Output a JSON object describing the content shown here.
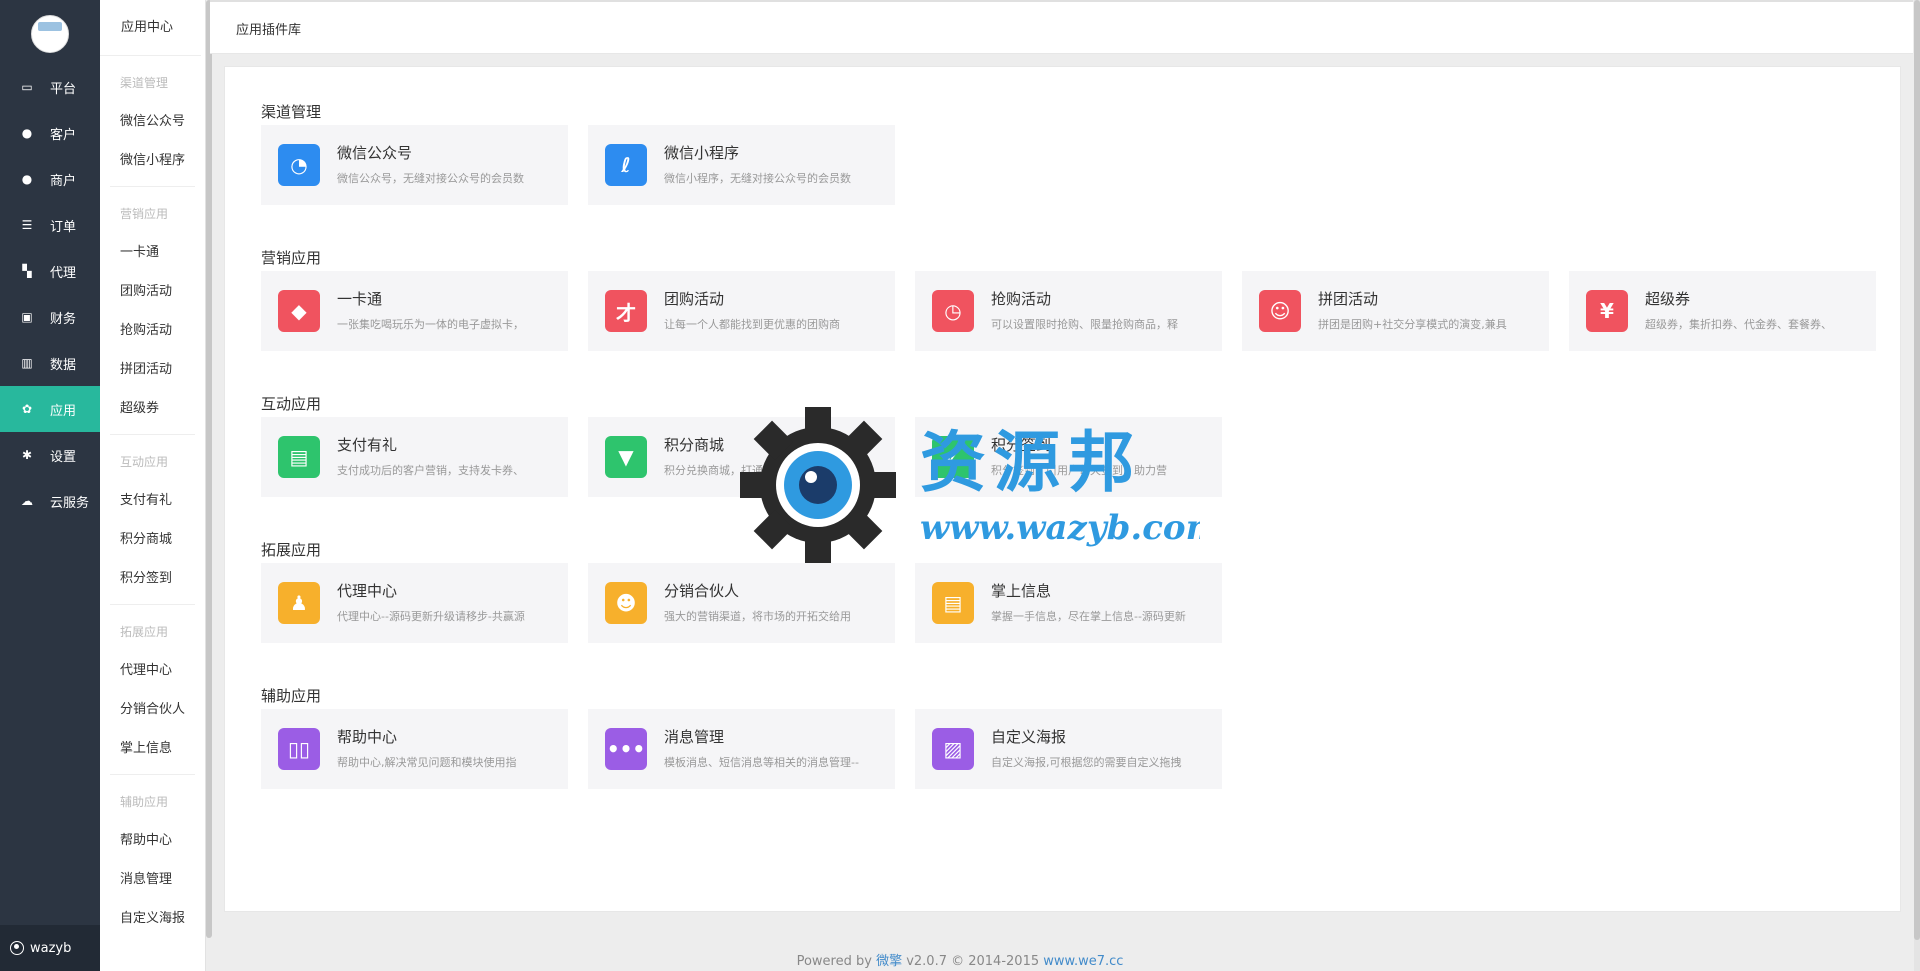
{
  "nav": {
    "items": [
      {
        "label": "平台",
        "icon": "monitor-icon"
      },
      {
        "label": "客户",
        "icon": "user-icon"
      },
      {
        "label": "商户",
        "icon": "users-icon"
      },
      {
        "label": "订单",
        "icon": "list-icon"
      },
      {
        "label": "代理",
        "icon": "map-icon"
      },
      {
        "label": "财务",
        "icon": "money-icon"
      },
      {
        "label": "数据",
        "icon": "bar-chart-icon"
      },
      {
        "label": "应用",
        "icon": "apps-icon",
        "active": true
      },
      {
        "label": "设置",
        "icon": "gear-icon"
      },
      {
        "label": "云服务",
        "icon": "cloud-icon"
      }
    ],
    "user": "wazyb"
  },
  "subnav": {
    "title": "应用中心",
    "groups": [
      {
        "name": "渠道管理",
        "items": [
          "微信公众号",
          "微信小程序"
        ]
      },
      {
        "name": "营销应用",
        "items": [
          "一卡通",
          "团购活动",
          "抢购活动",
          "拼团活动",
          "超级券"
        ]
      },
      {
        "name": "互动应用",
        "items": [
          "支付有礼",
          "积分商城",
          "积分签到"
        ]
      },
      {
        "name": "拓展应用",
        "items": [
          "代理中心",
          "分销合伙人",
          "掌上信息"
        ]
      },
      {
        "name": "辅助应用",
        "items": [
          "帮助中心",
          "消息管理",
          "自定义海报"
        ]
      }
    ]
  },
  "header": {
    "title": "应用插件库"
  },
  "sections": [
    {
      "title": "渠道管理",
      "cards": [
        {
          "name": "微信公众号",
          "desc": "微信公众号，无缝对接公众号的会员数",
          "color": "#2d8cf0",
          "icon": "wechat-icon"
        },
        {
          "name": "微信小程序",
          "desc": "微信小程序，无缝对接公众号的会员数",
          "color": "#2d8cf0",
          "icon": "miniprogram-icon"
        }
      ]
    },
    {
      "title": "营销应用",
      "cards": [
        {
          "name": "一卡通",
          "desc": "一张集吃喝玩乐为一体的电子虚拟卡，",
          "color": "#f0535f",
          "icon": "diamond-icon"
        },
        {
          "name": "团购活动",
          "desc": "让每一个人都能找到更优惠的团购商",
          "color": "#f0535f",
          "icon": "group-buy-icon"
        },
        {
          "name": "抢购活动",
          "desc": "可以设置限时抢购、限量抢购商品，释",
          "color": "#f0535f",
          "icon": "stopwatch-icon"
        },
        {
          "name": "拼团活动",
          "desc": "拼团是团购+社交分享模式的演变,兼具",
          "color": "#f0535f",
          "icon": "team-icon"
        },
        {
          "name": "超级券",
          "desc": "超级券，集折扣券、代金券、套餐券、",
          "color": "#f0535f",
          "icon": "coupon-icon"
        }
      ]
    },
    {
      "title": "互动应用",
      "cards": [
        {
          "name": "支付有礼",
          "desc": "支付成功后的客户营销，支持发卡券、",
          "color": "#2ec46d",
          "icon": "gift-icon"
        },
        {
          "name": "积分商城",
          "desc": "积分兑换商城，打通第三方积分体系",
          "color": "#2ec46d",
          "icon": "shopping-bag-icon"
        },
        {
          "name": "积分签到",
          "desc": "积分签到，引用户每天签到，助力营",
          "color": "#2ec46d",
          "icon": "checkin-icon"
        }
      ]
    },
    {
      "title": "拓展应用",
      "cards": [
        {
          "name": "代理中心",
          "desc": "代理中心--源码更新升级请移步-共赢源",
          "color": "#f7b02c",
          "icon": "agent-icon"
        },
        {
          "name": "分销合伙人",
          "desc": "强大的营销渠道，将市场的开拓交给用",
          "color": "#f7b02c",
          "icon": "partners-icon"
        },
        {
          "name": "掌上信息",
          "desc": "掌握一手信息，尽在掌上信息--源码更新",
          "color": "#f7b02c",
          "icon": "message-box-icon"
        }
      ]
    },
    {
      "title": "辅助应用",
      "cards": [
        {
          "name": "帮助中心",
          "desc": "帮助中心,解决常见问题和模块使用指",
          "color": "#9b5de5",
          "icon": "book-icon"
        },
        {
          "name": "消息管理",
          "desc": "模板消息、短信消息等相关的消息管理--",
          "color": "#9b5de5",
          "icon": "chat-icon"
        },
        {
          "name": "自定义海报",
          "desc": "自定义海报,可根据您的需要自定义拖拽",
          "color": "#9b5de5",
          "icon": "image-icon"
        }
      ]
    }
  ],
  "footer": {
    "prefix": "Powered by ",
    "brand": "微擎",
    "version": " v2.0.7 © 2014-2015 ",
    "site": "www.we7.cc"
  },
  "watermark": {
    "text": "资源邦",
    "url": "www.wazyb.com"
  }
}
